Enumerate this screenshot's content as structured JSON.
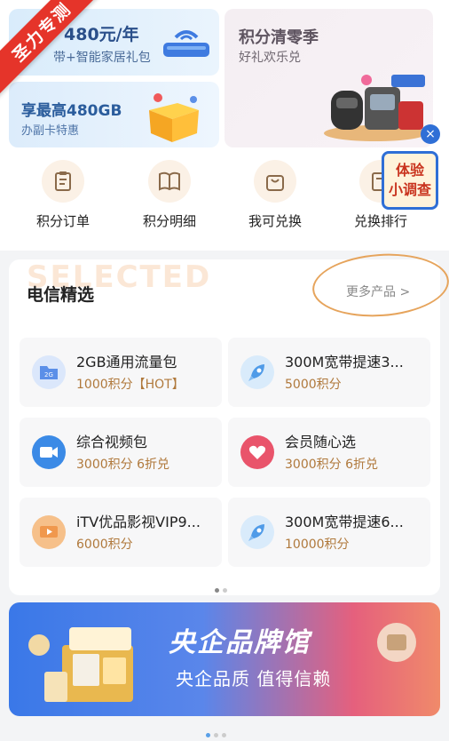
{
  "ribbon": {
    "text": "圣力专测"
  },
  "promos": {
    "card1": {
      "title": "480元/年",
      "subtitle": "带+智能家居礼包"
    },
    "card2": {
      "title": "享最高480GB",
      "subtitle": "办副卡特惠"
    },
    "card3": {
      "title": "积分清零季",
      "subtitle": "好礼欢乐兑"
    }
  },
  "survey": {
    "line1": "体验",
    "line2": "小调查",
    "close": "×"
  },
  "quick_nav": [
    {
      "label": "积分订单",
      "icon": "clipboard-icon"
    },
    {
      "label": "积分明细",
      "icon": "book-icon"
    },
    {
      "label": "我可兑换",
      "icon": "bag-icon"
    },
    {
      "label": "兑换排行",
      "icon": "ranking-icon"
    }
  ],
  "selected": {
    "watermark": "SELECTED",
    "title": "电信精选",
    "more": "更多产品 >",
    "products": [
      {
        "name": "2GB通用流量包",
        "price": "1000积分【HOT】",
        "icon": "data-card-icon",
        "color": "#5b8fe8"
      },
      {
        "name": "300M宽带提速3...",
        "price": "5000积分",
        "icon": "rocket-icon",
        "color": "#4f9be8"
      },
      {
        "name": "综合视频包",
        "price": "3000积分 6折兑",
        "icon": "video-icon",
        "color": "#3b8ae6"
      },
      {
        "name": "会员随心选",
        "price": "3000积分 6折兑",
        "icon": "heart-icon",
        "color": "#e9546b"
      },
      {
        "name": "iTV优品影视VIP9...",
        "price": "6000积分",
        "icon": "tv-icon",
        "color": "#f0984d"
      },
      {
        "name": "300M宽带提速6...",
        "price": "10000积分",
        "icon": "rocket-icon",
        "color": "#4f9be8"
      }
    ]
  },
  "banner": {
    "title": "央企品牌馆",
    "subtitle": "央企品质 值得信赖"
  }
}
